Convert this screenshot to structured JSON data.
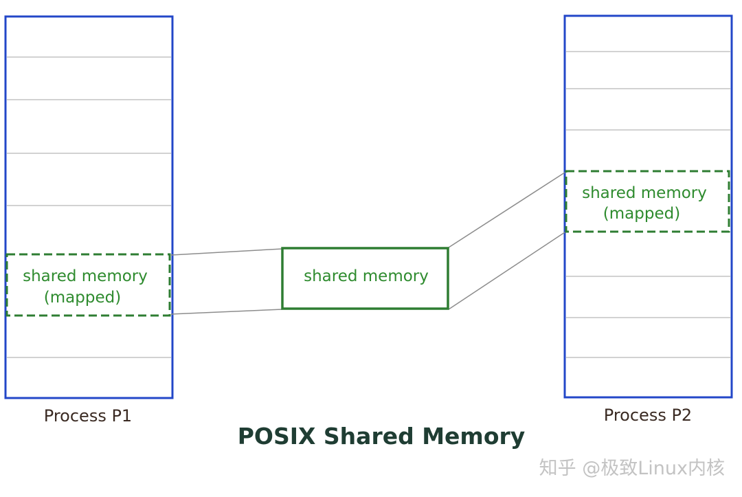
{
  "title": "POSIX Shared Memory",
  "process_p1": {
    "label": "Process P1",
    "mapped_region": {
      "line1": "shared memory",
      "line2": "(mapped)"
    }
  },
  "process_p2": {
    "label": "Process P2",
    "mapped_region": {
      "line1": "shared memory",
      "line2": "(mapped)"
    }
  },
  "shared_object": {
    "label": "shared memory"
  },
  "watermark": "知乎 @极致Linux内核",
  "colors": {
    "process_border": "#2347c8",
    "shared_green": "#2e7d32",
    "divider_gray": "#bdbdbd",
    "connector_gray": "#8c8c8c"
  }
}
